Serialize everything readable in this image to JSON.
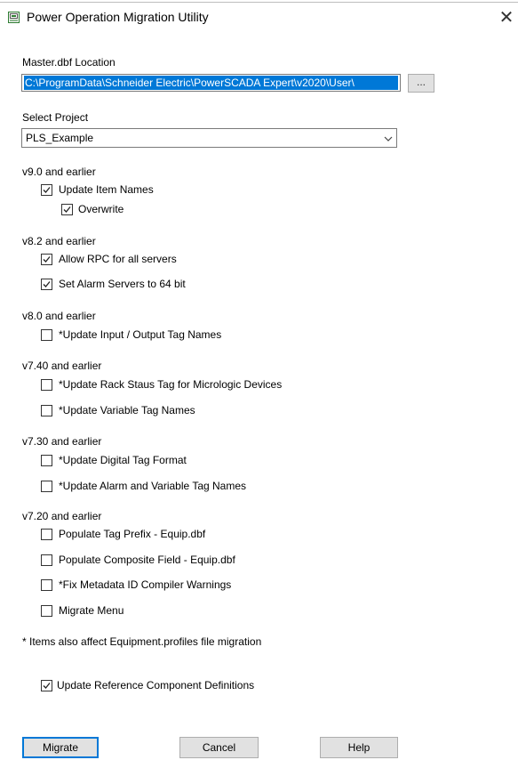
{
  "window": {
    "title": "Power Operation Migration Utility",
    "close_glyph": "✕",
    "app_icon": "app-window-icon"
  },
  "master": {
    "label": "Master.dbf Location",
    "path": "C:\\ProgramData\\Schneider Electric\\PowerSCADA Expert\\v2020\\User\\",
    "browse_label": "..."
  },
  "project": {
    "label": "Select Project",
    "value": "PLS_Example"
  },
  "sections": {
    "v90": {
      "heading": "v9.0 and earlier",
      "items": [
        {
          "label": "Update Item Names",
          "checked": true
        },
        {
          "label": "Overwrite",
          "checked": true
        }
      ]
    },
    "v82": {
      "heading": "v8.2 and earlier",
      "items": [
        {
          "label": "Allow RPC for all servers",
          "checked": true
        },
        {
          "label": "Set Alarm Servers to 64 bit",
          "checked": true
        }
      ]
    },
    "v80": {
      "heading": "v8.0 and earlier",
      "items": [
        {
          "label": "*Update Input / Output Tag Names",
          "checked": false
        }
      ]
    },
    "v740": {
      "heading": "v7.40 and earlier",
      "items": [
        {
          "label": "*Update Rack Staus Tag for Micrologic Devices",
          "checked": false
        },
        {
          "label": "*Update Variable Tag Names",
          "checked": false
        }
      ]
    },
    "v730": {
      "heading": "v7.30 and earlier",
      "items": [
        {
          "label": "*Update Digital Tag Format",
          "checked": false
        },
        {
          "label": "*Update Alarm and Variable Tag Names",
          "checked": false
        }
      ]
    },
    "v720": {
      "heading": "v7.20 and earlier",
      "items": [
        {
          "label": "Populate Tag Prefix - Equip.dbf",
          "checked": false
        },
        {
          "label": "Populate Composite Field - Equip.dbf",
          "checked": false
        },
        {
          "label": "*Fix Metadata ID Compiler Warnings",
          "checked": false
        },
        {
          "label": "Migrate Menu",
          "checked": false
        }
      ]
    }
  },
  "footnote": "* Items also affect Equipment.profiles file migration",
  "reference": {
    "label": "Update Reference Component Definitions",
    "checked": true
  },
  "buttons": {
    "migrate": "Migrate",
    "cancel": "Cancel",
    "help": "Help"
  },
  "colors": {
    "selection": "#0078d7",
    "button_face": "#e1e1e1"
  }
}
